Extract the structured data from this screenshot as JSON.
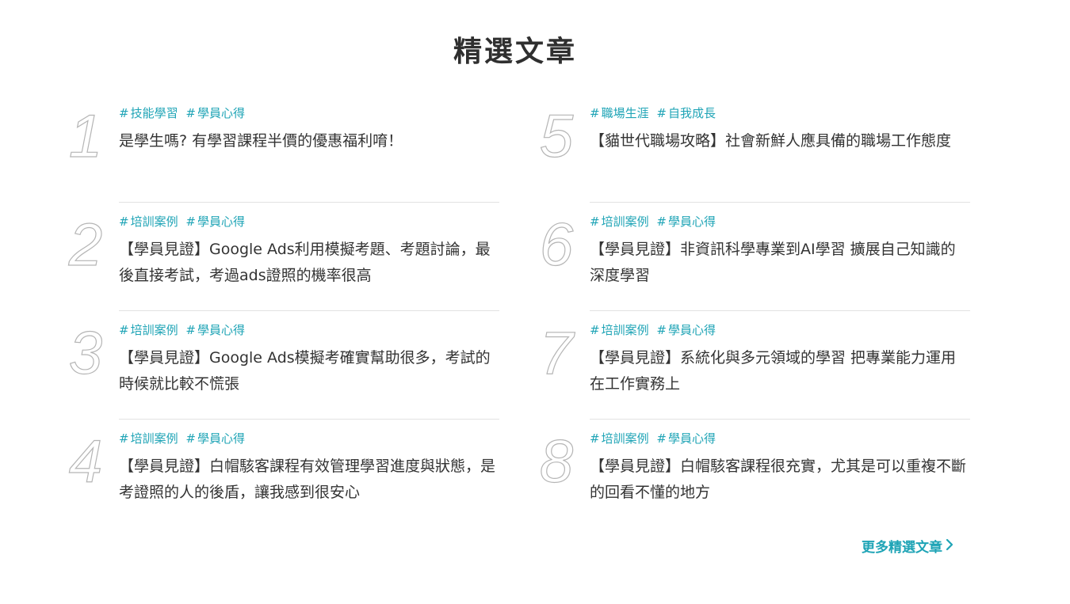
{
  "section": {
    "title": "精選文章",
    "more_label": "更多精選文章"
  },
  "colors": {
    "accent": "#1fa4b6",
    "number_outline": "#b5b5b5",
    "divider": "#e2e2e2",
    "text": "#333333"
  },
  "icons": {
    "more": "chevron-right-icon"
  },
  "articles_left": [
    {
      "number": "1",
      "tags": [
        "技能學習",
        "學員心得"
      ],
      "title": "是學生嗎? 有學習課程半價的優惠福利唷！"
    },
    {
      "number": "2",
      "tags": [
        "培訓案例",
        "學員心得"
      ],
      "title": "【學員見證】Google Ads利用模擬考題、考題討論，最後直接考試，考過ads證照的機率很高"
    },
    {
      "number": "3",
      "tags": [
        "培訓案例",
        "學員心得"
      ],
      "title": "【學員見證】Google Ads模擬考確實幫助很多，考試的時候就比較不慌張"
    },
    {
      "number": "4",
      "tags": [
        "培訓案例",
        "學員心得"
      ],
      "title": "【學員見證】白帽駭客課程有效管理學習進度與狀態，是考證照的人的後盾，讓我感到很安心"
    }
  ],
  "articles_right": [
    {
      "number": "5",
      "tags": [
        "職場生涯",
        "自我成長"
      ],
      "title": "【貓世代職場攻略】社會新鮮人應具備的職場工作態度"
    },
    {
      "number": "6",
      "tags": [
        "培訓案例",
        "學員心得"
      ],
      "title": "【學員見證】非資訊科學專業到AI學習 擴展自己知識的深度學習"
    },
    {
      "number": "7",
      "tags": [
        "培訓案例",
        "學員心得"
      ],
      "title": "【學員見證】系統化與多元領域的學習 把專業能力運用在工作實務上"
    },
    {
      "number": "8",
      "tags": [
        "培訓案例",
        "學員心得"
      ],
      "title": "【學員見證】白帽駭客課程很充實，尤其是可以重複不斷的回看不懂的地方"
    }
  ]
}
